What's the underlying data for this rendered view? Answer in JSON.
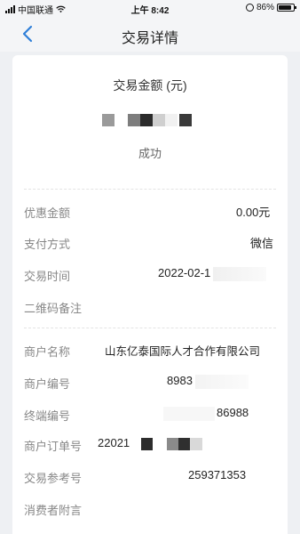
{
  "status_bar": {
    "carrier": "中国联通",
    "time": "上午 8:42",
    "battery": "86%"
  },
  "nav": {
    "title": "交易详情",
    "back_icon": "chevron-left-icon"
  },
  "summary": {
    "amount_title": "交易金额 (元)",
    "status": "成功"
  },
  "details": [
    {
      "label": "优惠金额",
      "value": "0.00元"
    },
    {
      "label": "支付方式",
      "value": "微信"
    },
    {
      "label": "交易时间",
      "value": "2022-02-1"
    },
    {
      "label": "二维码备注",
      "value": ""
    }
  ],
  "merchant": [
    {
      "label": "商户名称",
      "value": "山东亿泰国际人才合作有限公司"
    },
    {
      "label": "商户编号",
      "value": "8983"
    },
    {
      "label": "终端编号",
      "value": "86988"
    },
    {
      "label": "商户订单号",
      "value": "22021"
    },
    {
      "label": "交易参考号",
      "value": "259371353"
    },
    {
      "label": "消费者附言",
      "value": ""
    }
  ],
  "colors": {
    "accent": "#2f7fd8",
    "background": "#eef0f3",
    "card": "#ffffff"
  }
}
